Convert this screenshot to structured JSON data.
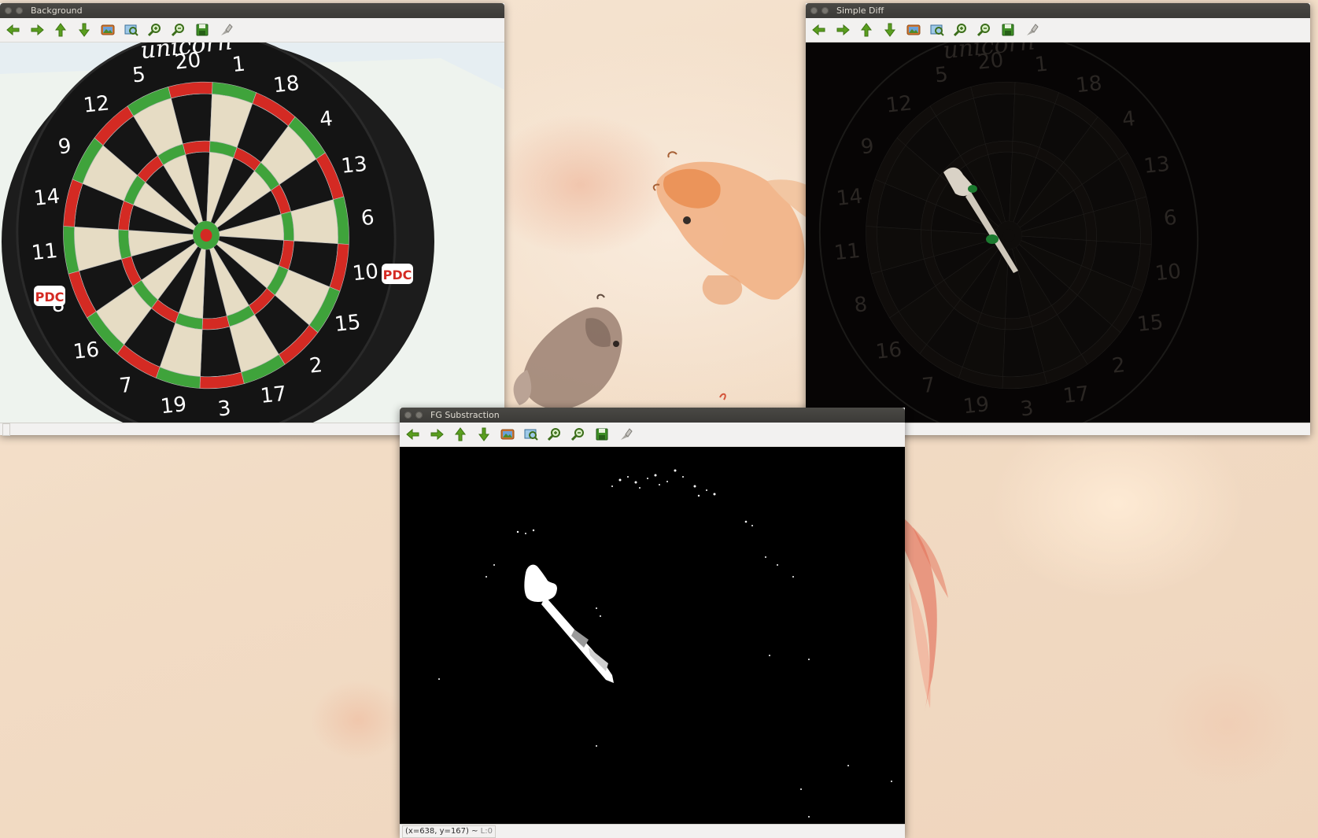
{
  "desktop": {
    "accent": "#f1dcc6"
  },
  "toolbar_icons": [
    {
      "name": "arrow-left-icon",
      "label": "Pan left"
    },
    {
      "name": "arrow-right-icon",
      "label": "Pan right"
    },
    {
      "name": "arrow-up-icon",
      "label": "Pan up"
    },
    {
      "name": "arrow-down-icon",
      "label": "Pan down"
    },
    {
      "name": "image-icon",
      "label": "Zoom x1"
    },
    {
      "name": "zoom-fit-icon",
      "label": "Zoom to fit"
    },
    {
      "name": "zoom-in-icon",
      "label": "Zoom in"
    },
    {
      "name": "zoom-out-icon",
      "label": "Zoom out"
    },
    {
      "name": "save-icon",
      "label": "Save"
    },
    {
      "name": "properties-icon",
      "label": "Properties"
    }
  ],
  "windows": {
    "background": {
      "title": "Background"
    },
    "simple_diff": {
      "title": "Simple Diff"
    },
    "fg": {
      "title": "FG Substraction",
      "status": "(x=638, y=167) ~ ",
      "status_level": "L:0"
    }
  },
  "dartboard": {
    "numbers": [
      "20",
      "1",
      "18",
      "4",
      "13",
      "6",
      "10",
      "15",
      "2",
      "17",
      "3",
      "19",
      "7",
      "16",
      "8",
      "11",
      "14",
      "9",
      "12",
      "5"
    ],
    "brand": "unicorn",
    "logo": "PDC"
  },
  "colors": {
    "green": "#3fa33b",
    "red": "#d42a23",
    "cream": "#e6dcc4",
    "black": "#151515"
  }
}
